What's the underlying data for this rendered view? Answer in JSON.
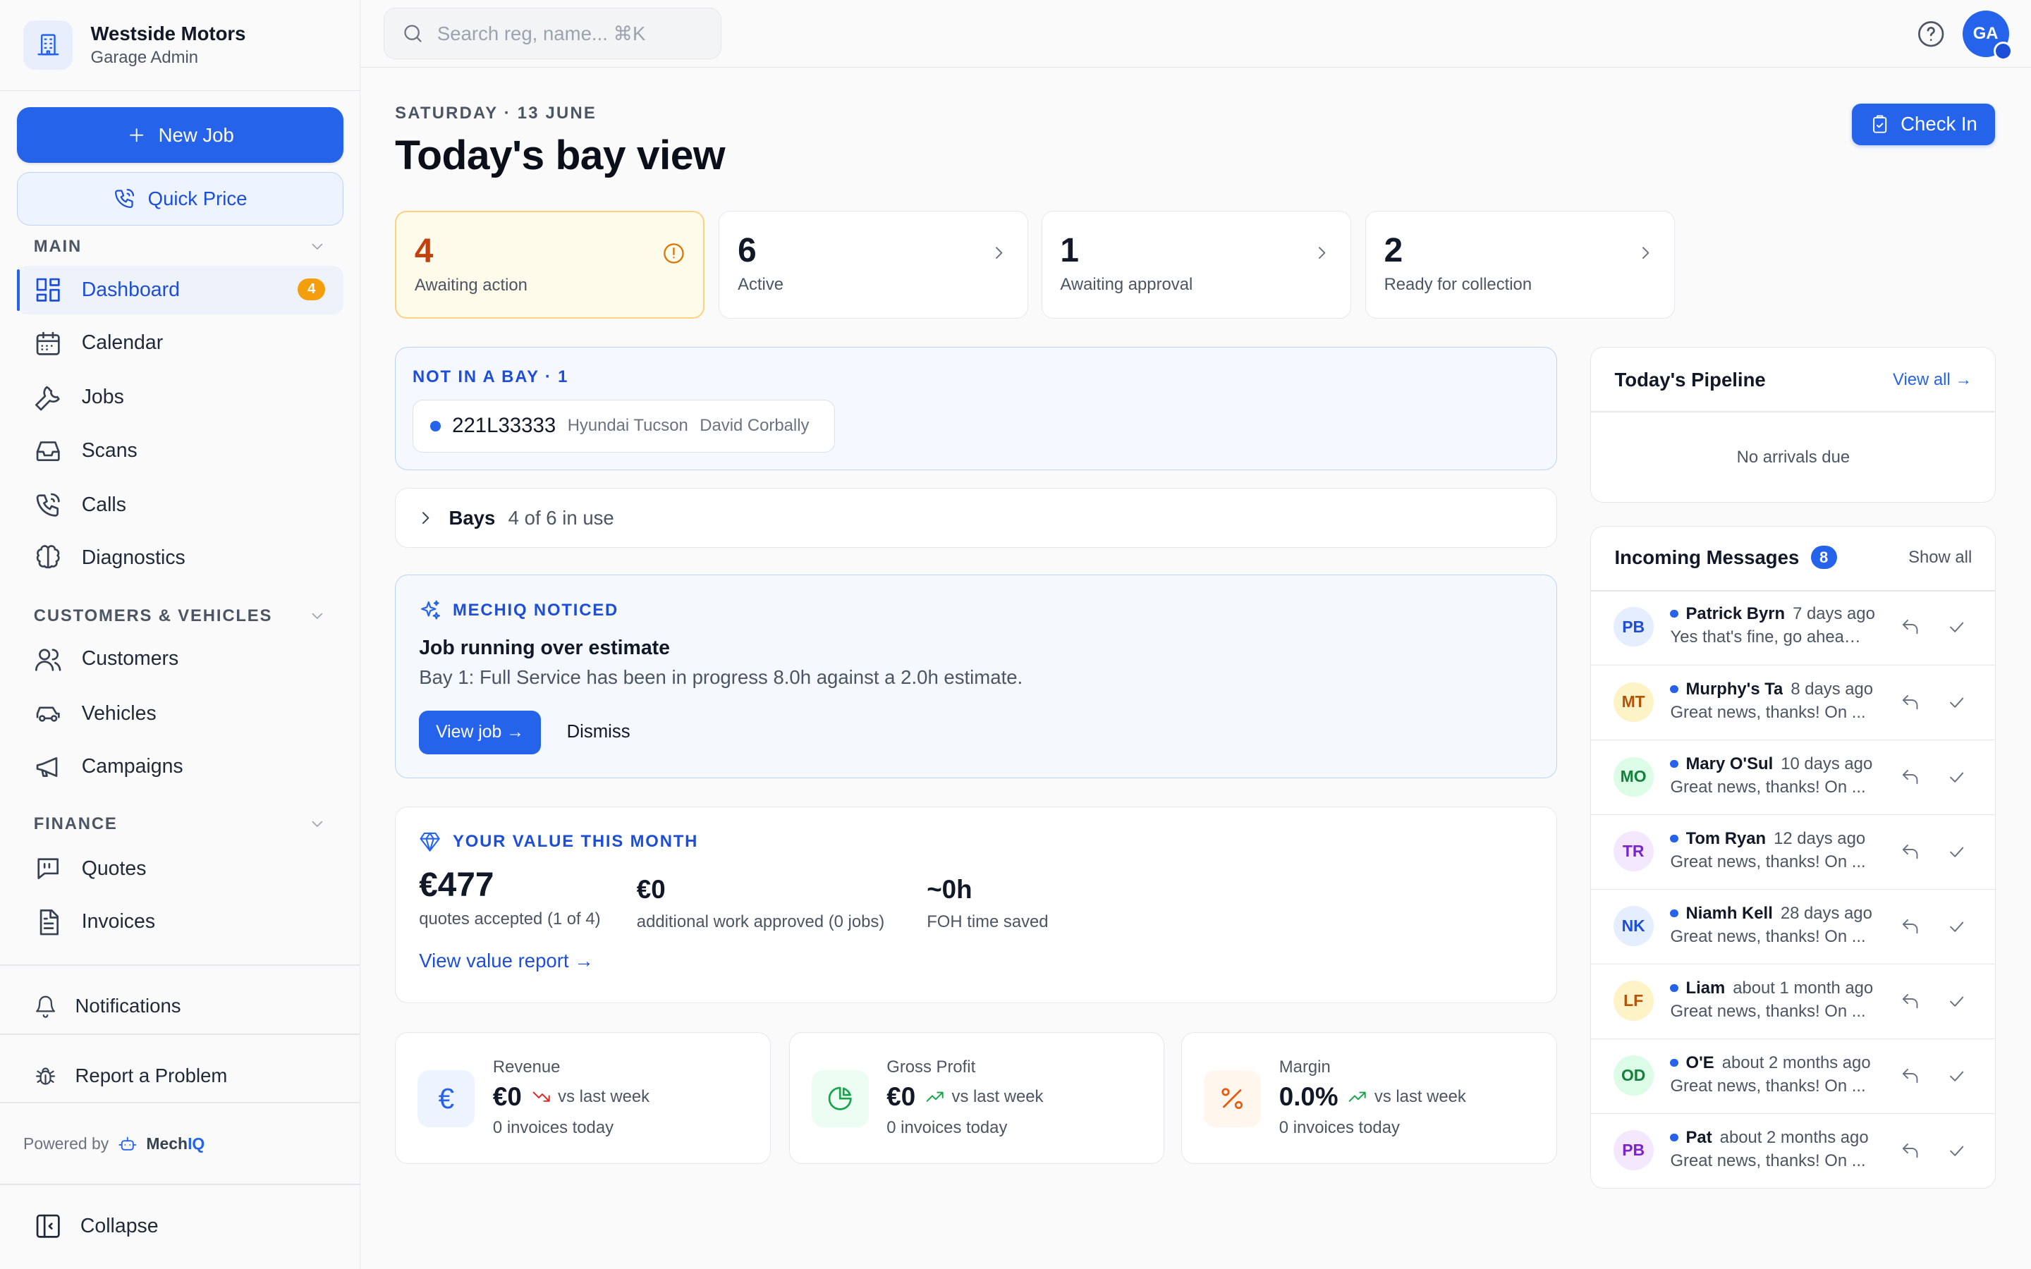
{
  "brand": {
    "name": "Westside Motors",
    "subtitle": "Garage Admin"
  },
  "actions": {
    "new_job": "New Job",
    "quick_price": "Quick Price"
  },
  "sidebar": {
    "sections": [
      {
        "label": "MAIN",
        "items": [
          {
            "label": "Dashboard",
            "icon": "dashboard-icon",
            "badge": "4",
            "active": true
          },
          {
            "label": "Calendar",
            "icon": "calendar-icon"
          },
          {
            "label": "Jobs",
            "icon": "wrench-icon"
          },
          {
            "label": "Scans",
            "icon": "inbox-icon"
          },
          {
            "label": "Calls",
            "icon": "phone-icon"
          },
          {
            "label": "Diagnostics",
            "icon": "brain-icon"
          }
        ]
      },
      {
        "label": "CUSTOMERS & VEHICLES",
        "items": [
          {
            "label": "Customers",
            "icon": "users-icon"
          },
          {
            "label": "Vehicles",
            "icon": "car-icon"
          },
          {
            "label": "Campaigns",
            "icon": "megaphone-icon"
          }
        ]
      },
      {
        "label": "FINANCE",
        "items": [
          {
            "label": "Quotes",
            "icon": "quote-icon"
          },
          {
            "label": "Invoices",
            "icon": "invoice-icon"
          }
        ]
      }
    ],
    "notifications": "Notifications",
    "report_problem": "Report a Problem",
    "powered_by": "Powered by",
    "powered_brand_a": "Mech",
    "powered_brand_b": "IQ",
    "collapse": "Collapse"
  },
  "topbar": {
    "search_placeholder": "Search reg, name... ⌘K",
    "avatar": "GA"
  },
  "header": {
    "date": "SATURDAY · 13 JUNE",
    "title": "Today's bay view",
    "check_in": "Check In"
  },
  "stats": [
    {
      "value": "4",
      "label": "Awaiting action",
      "variant": "warning"
    },
    {
      "value": "6",
      "label": "Active"
    },
    {
      "value": "1",
      "label": "Awaiting approval"
    },
    {
      "value": "2",
      "label": "Ready for collection"
    }
  ],
  "not_in_bay": {
    "title": "NOT IN A BAY · 1",
    "vehicles": [
      {
        "reg": "221L33333",
        "model": "Hyundai Tucson",
        "customer": "David Corbally"
      }
    ]
  },
  "bays": {
    "title": "Bays",
    "usage": "4 of 6 in use"
  },
  "mechiq": {
    "label": "MECHIQ NOTICED",
    "title": "Job running over estimate",
    "description": "Bay 1: Full Service has been in progress 8.0h against a 2.0h estimate.",
    "view_button": "View job →",
    "dismiss_button": "Dismiss"
  },
  "value_month": {
    "label": "YOUR VALUE THIS MONTH",
    "metrics": [
      {
        "value": "€477",
        "label": "quotes accepted (1 of 4)"
      },
      {
        "value": "€0",
        "label": "additional work approved (0 jobs)"
      },
      {
        "value": "~0h",
        "label": "FOH time saved"
      }
    ],
    "link": "View value report →"
  },
  "kpis": [
    {
      "label": "Revenue",
      "value": "€0",
      "trend": "down",
      "vs": "vs last week",
      "sub": "0 invoices today",
      "icon": "euro-icon",
      "color": "#2563eb"
    },
    {
      "label": "Gross Profit",
      "value": "€0",
      "trend": "up",
      "vs": "vs last week",
      "sub": "0 invoices today",
      "icon": "pie-chart-icon",
      "color": "#16a34a"
    },
    {
      "label": "Margin",
      "value": "0.0%",
      "trend": "up",
      "vs": "vs last week",
      "sub": "0 invoices today",
      "icon": "percent-icon",
      "color": "#ea580c"
    }
  ],
  "pipeline": {
    "title": "Today's Pipeline",
    "link": "View all →",
    "empty": "No arrivals due"
  },
  "messages": {
    "title": "Incoming Messages",
    "count": "8",
    "link": "Show all",
    "items": [
      {
        "initials": "PB",
        "name": "Patrick Byrn",
        "time": "7 days ago",
        "preview": "Yes that's fine, go ahead ...",
        "color": "blue"
      },
      {
        "initials": "MT",
        "name": "Murphy's Ta",
        "time": "8 days ago",
        "preview": "Great news, thanks! On ...",
        "color": "amber"
      },
      {
        "initials": "MO",
        "name": "Mary O'Sul",
        "time": "10 days ago",
        "preview": "Great news, thanks! On ...",
        "color": "green"
      },
      {
        "initials": "TR",
        "name": "Tom Ryan",
        "time": "12 days ago",
        "preview": "Great news, thanks! On ...",
        "color": "purple"
      },
      {
        "initials": "NK",
        "name": "Niamh Kell",
        "time": "28 days ago",
        "preview": "Great news, thanks! On ...",
        "color": "blue"
      },
      {
        "initials": "LF",
        "name": "Liam",
        "time": "about 1 month ago",
        "preview": "Great news, thanks! On ...",
        "color": "amber"
      },
      {
        "initials": "OD",
        "name": "O'E",
        "time": "about 2 months ago",
        "preview": "Great news, thanks! On ...",
        "color": "green"
      },
      {
        "initials": "PB",
        "name": "Pat",
        "time": "about 2 months ago",
        "preview": "Great news, thanks! On ...",
        "color": "purple"
      }
    ]
  }
}
